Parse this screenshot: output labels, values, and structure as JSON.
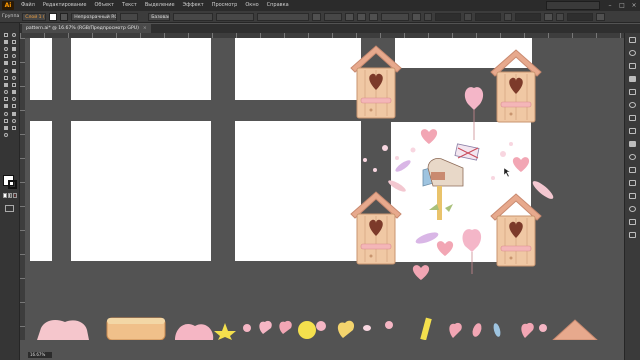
{
  "app": {
    "logo_text": "Ai",
    "menu": [
      "Файл",
      "Редактирование",
      "Объект",
      "Текст",
      "Выделение",
      "Эффект",
      "Просмотр",
      "Окно",
      "Справка"
    ],
    "window_controls": [
      "–",
      "□",
      "×"
    ]
  },
  "control_bar": {
    "selection_type": "Группа",
    "layer": "Слой 1 (Lag)",
    "color_mode": "Непрозрачный RGB-об...",
    "style": "Базовая"
  },
  "document": {
    "tab_title": "pattern.ai* @ 16.67% (RGB/Предпросмотр GPU)",
    "tab_close": "×"
  },
  "status": {
    "zoom": "16.67%"
  },
  "colors": {
    "menubar_bg": "#2b2b2b",
    "panel_bg": "#3c3c3c",
    "canvas_bg": "#535353",
    "artboard_bg": "#ffffff",
    "accent": "#ff9a00",
    "house_body": "#f0c8a4",
    "house_roof": "#e7a98d",
    "house_heart": "#7c3a2a",
    "pink_heart": "#f2a6b4",
    "lavender": "#d9b6e6",
    "yellow_star": "#f4e04d",
    "mailbox_blue": "#9ec4e0"
  },
  "icons": {
    "left_tools": [
      "selection-tool",
      "direct-selection-tool",
      "magic-wand-tool",
      "lasso-tool",
      "pen-tool",
      "curvature-tool",
      "type-tool",
      "line-segment-tool",
      "rectangle-tool",
      "paintbrush-tool",
      "shaper-tool",
      "pencil-tool",
      "eraser-tool",
      "rotate-tool",
      "scale-tool",
      "width-tool",
      "free-transform-tool",
      "shape-builder-tool",
      "perspective-grid-tool",
      "mesh-tool",
      "gradient-tool",
      "eyedropper-tool",
      "blend-tool",
      "symbol-sprayer-tool",
      "column-graph-tool",
      "artboard-tool",
      "slice-tool",
      "hand-tool",
      "zoom-tool"
    ],
    "right_panels": [
      "color-panel-icon",
      "color-guide-icon",
      "swatches-icon",
      "brushes-icon",
      "symbols-icon",
      "stroke-icon",
      "gradient-icon",
      "transparency-icon",
      "appearance-icon",
      "graphic-styles-icon",
      "layers-icon",
      "artboards-icon",
      "align-icon",
      "transform-icon",
      "pathfinder-icon",
      "links-icon"
    ]
  }
}
